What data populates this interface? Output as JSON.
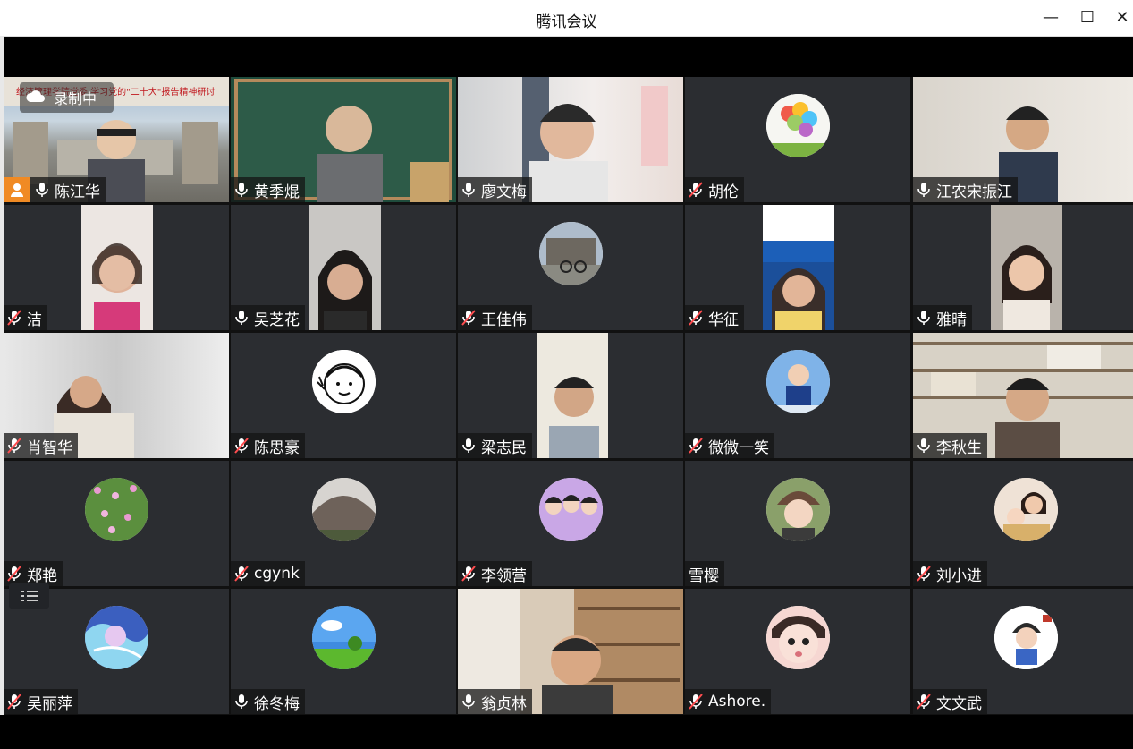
{
  "app": {
    "title": "腾讯会议"
  },
  "window_controls": {
    "minimize": "—",
    "maximize": "☐",
    "close": "✕"
  },
  "recording": {
    "label": "录制中"
  },
  "participants": [
    {
      "name": "陈江华",
      "mic": "on",
      "view": "video",
      "host": true
    },
    {
      "name": "黄季焜",
      "mic": "on",
      "view": "video"
    },
    {
      "name": "廖文梅",
      "mic": "on",
      "view": "video"
    },
    {
      "name": "胡伦",
      "mic": "muted",
      "view": "avatar"
    },
    {
      "name": "江农宋振江",
      "mic": "on",
      "view": "video"
    },
    {
      "name": "洁",
      "mic": "muted",
      "view": "video"
    },
    {
      "name": "吴芝花",
      "mic": "on",
      "view": "video"
    },
    {
      "name": "王佳伟",
      "mic": "muted",
      "view": "avatar"
    },
    {
      "name": "华征",
      "mic": "muted",
      "view": "video"
    },
    {
      "name": "雅晴",
      "mic": "on",
      "view": "video"
    },
    {
      "name": "肖智华",
      "mic": "muted",
      "view": "video"
    },
    {
      "name": "陈思豪",
      "mic": "muted",
      "view": "avatar"
    },
    {
      "name": "梁志民",
      "mic": "on",
      "view": "video"
    },
    {
      "name": "微微一笑",
      "mic": "muted",
      "view": "avatar"
    },
    {
      "name": "李秋生",
      "mic": "on",
      "view": "video"
    },
    {
      "name": "郑艳",
      "mic": "muted",
      "view": "avatar"
    },
    {
      "name": "cgynk",
      "mic": "muted",
      "view": "avatar"
    },
    {
      "name": "李领营",
      "mic": "muted",
      "view": "avatar"
    },
    {
      "name": "雪樱",
      "mic": "none",
      "view": "avatar"
    },
    {
      "name": "刘小进",
      "mic": "muted",
      "view": "avatar"
    },
    {
      "name": "吴丽萍",
      "mic": "muted",
      "view": "avatar"
    },
    {
      "name": "徐冬梅",
      "mic": "on",
      "view": "avatar"
    },
    {
      "name": "翁贞林",
      "mic": "on",
      "view": "video"
    },
    {
      "name": "Ashore.",
      "mic": "muted",
      "view": "avatar"
    },
    {
      "name": "文文武",
      "mic": "muted",
      "view": "avatar"
    }
  ],
  "colors": {
    "tile_bg": "#2b2d31",
    "host_badge": "#f08a24",
    "active_border": "#2fa84f",
    "muted_icon": "#ff4d4f"
  }
}
